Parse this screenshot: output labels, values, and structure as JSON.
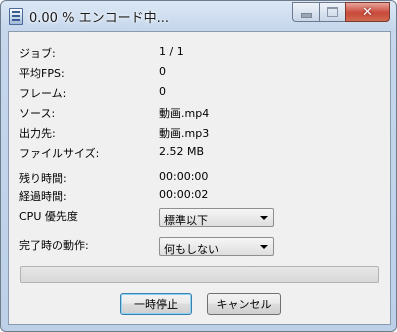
{
  "window": {
    "title": "0.00 % エンコード中..."
  },
  "caption": {
    "close_glyph": "✕"
  },
  "info": {
    "job_label": "ジョブ:",
    "job_value": "1 / 1",
    "fps_label": "平均FPS:",
    "fps_value": "0",
    "frames_label": "フレーム:",
    "frames_value": "0",
    "source_label": "ソース:",
    "source_value": "動画.mp4",
    "output_label": "出力先:",
    "output_value": "動画.mp3",
    "filesize_label": "ファイルサイズ:",
    "filesize_value": "2.52 MB",
    "remaining_label": "残り時間:",
    "remaining_value": "00:00:00",
    "elapsed_label": "経過時間:",
    "elapsed_value": "00:00:02"
  },
  "priority": {
    "label": "CPU 優先度",
    "selected": "標準以下"
  },
  "completion": {
    "label": "完了時の動作:",
    "selected": "何もしない"
  },
  "progress": {
    "percent": 0
  },
  "buttons": {
    "pause_label": "一時停止",
    "cancel_label": "キャンセル"
  }
}
